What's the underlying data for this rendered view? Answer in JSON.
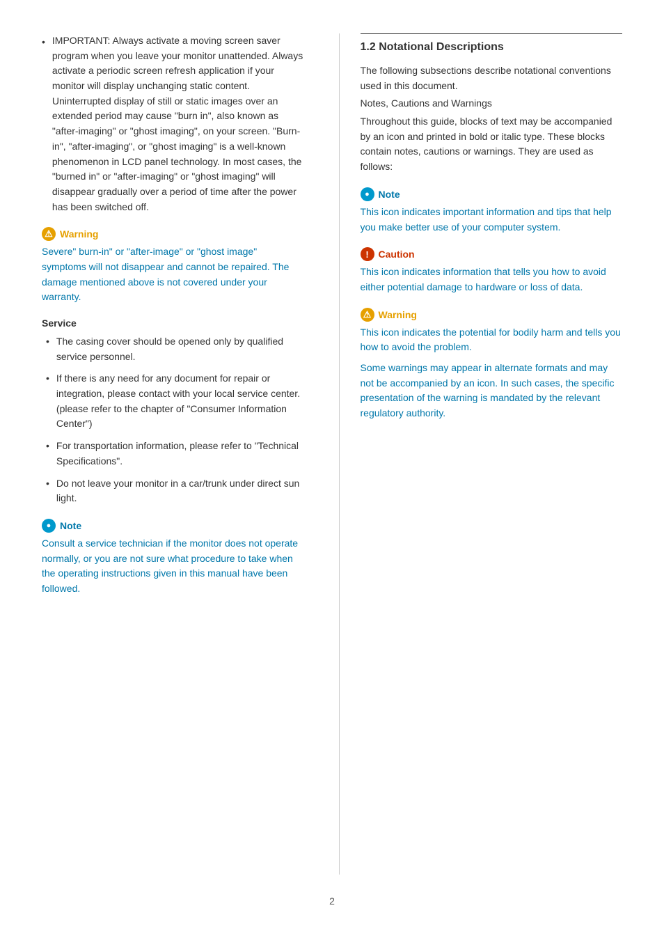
{
  "left": {
    "bullet_main": "IMPORTANT: Always activate a moving screen saver program when you leave your monitor unattended. Always activate a periodic screen refresh application if your monitor will display unchanging static content. Uninterrupted display of still or static images over an extended period may cause \"burn in\", also known as \"after-imaging\" or \"ghost imaging\", on your screen. \"Burn-in\", \"after-imaging\", or \"ghost imaging\" is a well-known phenomenon in LCD panel technology. In most cases, the \"burned in\" or \"after-imaging\" or \"ghost imaging\" will disappear gradually over a period of time after the power has been switched off.",
    "warning1_header": "Warning",
    "warning1_body": "Severe\" burn-in\" or \"after-image\" or \"ghost image\" symptoms will not disappear and cannot be repaired. The damage mentioned above is not covered under your warranty.",
    "service_title": "Service",
    "service_bullets": [
      "The casing cover should be opened only by qualified service personnel.",
      "If there is any need for any document for repair or integration, please contact with your local service center. (please refer to the chapter of \"Consumer Information Center\")",
      "For transportation information, please refer to \"Technical Specifications\".",
      "Do not leave your monitor in a car/trunk under direct sun light."
    ],
    "note1_header": "Note",
    "note1_body": "Consult a service technician if the monitor does not operate normally, or you are not sure what procedure to take when the operating instructions given in this manual have been followed."
  },
  "right": {
    "section_title": "1.2 Notational Descriptions",
    "intro_text": "The following subsections describe notational conventions used in this document.",
    "notes_cautions_title": "Notes, Cautions and Warnings",
    "notes_cautions_body": "Throughout this guide, blocks of text may be accompanied by an icon and printed in bold or italic type. These blocks contain notes, cautions or warnings. They are used as follows:",
    "note_header": "Note",
    "note_body": "This icon indicates important information and tips that help you make better use of your computer system.",
    "caution_header": "Caution",
    "caution_body": "This icon indicates information that tells you how to avoid either potential damage to hardware or loss of data.",
    "warning_header": "Warning",
    "warning_body": "This icon indicates the potential for bodily harm and tells you how to avoid the problem.",
    "warning_body2": "Some warnings may appear in alternate formats and may not be accompanied by an icon. In such cases, the specific presentation of the warning is mandated by the relevant regulatory authority."
  },
  "page_number": "2"
}
